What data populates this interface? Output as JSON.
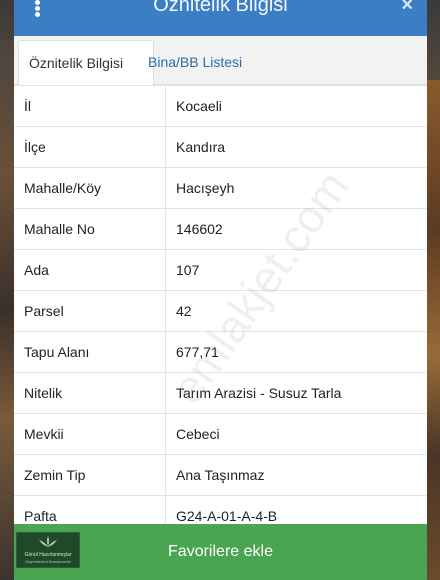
{
  "window": {
    "title": "Öznitelik Bilgisi",
    "close_glyph": "×"
  },
  "tabs": [
    {
      "label": "Öznitelik Bilgisi",
      "active": true
    },
    {
      "label": "Bina/BB Listesi",
      "active": false
    }
  ],
  "attributes": [
    {
      "key": "İl",
      "value": "Kocaeli"
    },
    {
      "key": "İlçe",
      "value": "Kandıra"
    },
    {
      "key": "Mahalle/Köy",
      "value": "Hacışeyh"
    },
    {
      "key": "Mahalle No",
      "value": "146602"
    },
    {
      "key": "Ada",
      "value": "107"
    },
    {
      "key": "Parsel",
      "value": "42"
    },
    {
      "key": "Tapu Alanı",
      "value": "677,71"
    },
    {
      "key": "Nitelik",
      "value": "Tarım Arazisi - Susuz Tarla"
    },
    {
      "key": "Mevkii",
      "value": "Cebeci"
    },
    {
      "key": "Zemin Tip",
      "value": "Ana Taşınmaz"
    },
    {
      "key": "Pafta",
      "value": "G24-A-01-A-4-B"
    }
  ],
  "actions": {
    "favorites_label": "Favorilere ekle"
  },
  "watermark": "emlakjet.com",
  "logo": {
    "name": "Gönül Hazırlanmışlar",
    "tagline": "Gayrimenkul Danışmanlık"
  },
  "colors": {
    "titlebar": "#3b7ec3",
    "tab_link": "#2d6ca8",
    "favorites_bg": "#4aa552"
  }
}
